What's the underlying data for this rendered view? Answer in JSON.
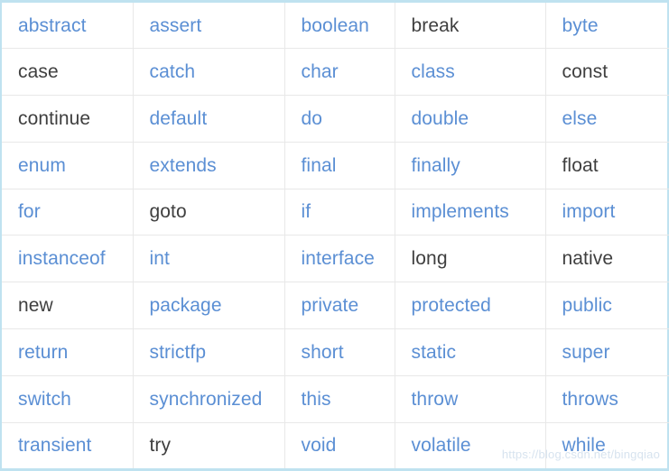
{
  "table": {
    "columns": 5,
    "rowCount": 10,
    "colors": {
      "link": "#5b8fd4",
      "plain": "#3f3f3f",
      "grid": "#e8e8e8",
      "outer_border": "#bfe2f0",
      "background": "#ffffff"
    },
    "rows": [
      [
        {
          "text": "abstract",
          "style": "link"
        },
        {
          "text": "assert",
          "style": "link"
        },
        {
          "text": "boolean",
          "style": "link"
        },
        {
          "text": "break",
          "style": "plain"
        },
        {
          "text": "byte",
          "style": "link"
        }
      ],
      [
        {
          "text": "case",
          "style": "plain"
        },
        {
          "text": "catch",
          "style": "link"
        },
        {
          "text": "char",
          "style": "link"
        },
        {
          "text": "class",
          "style": "link"
        },
        {
          "text": "const",
          "style": "plain"
        }
      ],
      [
        {
          "text": "continue",
          "style": "plain"
        },
        {
          "text": "default",
          "style": "link"
        },
        {
          "text": "do",
          "style": "link"
        },
        {
          "text": "double",
          "style": "link"
        },
        {
          "text": "else",
          "style": "link"
        }
      ],
      [
        {
          "text": "enum",
          "style": "link"
        },
        {
          "text": "extends",
          "style": "link"
        },
        {
          "text": "final",
          "style": "link"
        },
        {
          "text": "finally",
          "style": "link"
        },
        {
          "text": "float",
          "style": "plain"
        }
      ],
      [
        {
          "text": "for",
          "style": "link"
        },
        {
          "text": "goto",
          "style": "plain"
        },
        {
          "text": "if",
          "style": "link"
        },
        {
          "text": "implements",
          "style": "link"
        },
        {
          "text": "import",
          "style": "link"
        }
      ],
      [
        {
          "text": "instanceof",
          "style": "link"
        },
        {
          "text": "int",
          "style": "link"
        },
        {
          "text": "interface",
          "style": "link"
        },
        {
          "text": "long",
          "style": "plain"
        },
        {
          "text": "native",
          "style": "plain"
        }
      ],
      [
        {
          "text": "new",
          "style": "plain"
        },
        {
          "text": "package",
          "style": "link"
        },
        {
          "text": "private",
          "style": "link"
        },
        {
          "text": "protected",
          "style": "link"
        },
        {
          "text": "public",
          "style": "link"
        }
      ],
      [
        {
          "text": "return",
          "style": "link"
        },
        {
          "text": "strictfp",
          "style": "link"
        },
        {
          "text": "short",
          "style": "link"
        },
        {
          "text": "static",
          "style": "link"
        },
        {
          "text": "super",
          "style": "link"
        }
      ],
      [
        {
          "text": "switch",
          "style": "link"
        },
        {
          "text": "synchronized",
          "style": "link"
        },
        {
          "text": "this",
          "style": "link"
        },
        {
          "text": "throw",
          "style": "link"
        },
        {
          "text": "throws",
          "style": "link"
        }
      ],
      [
        {
          "text": "transient",
          "style": "link"
        },
        {
          "text": "try",
          "style": "plain"
        },
        {
          "text": "void",
          "style": "link"
        },
        {
          "text": "volatile",
          "style": "link"
        },
        {
          "text": "while",
          "style": "link"
        }
      ]
    ]
  },
  "watermark": {
    "text": "https://blog.csdn.net/bingqiao"
  }
}
